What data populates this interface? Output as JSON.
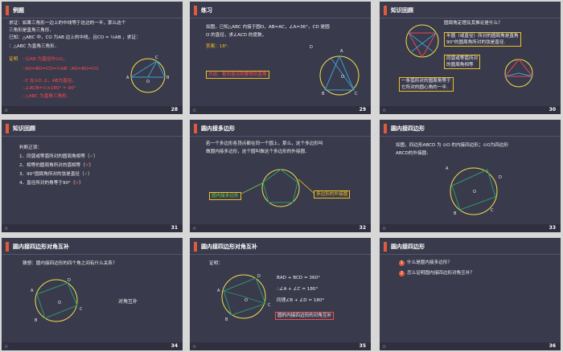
{
  "slides": [
    {
      "title": "例题",
      "num": "28",
      "lines": [
        "求证：如果三角形一边上的中线等于这边的一半，那么这个",
        "三角形是直角三角形．",
        "已知：△ABC 中，CO 为AB 边上的中线，且CO = ½AB ，求证：",
        "：△ABC 为直角三角形．"
      ],
      "proof_label": "证明",
      "proof": [
        "∵以AB 为直径作⊙O，",
        "∵AO=BO=CO=½AB  ∴AO=BO=CO",
        "∴C 在⊙O 上，AB为直径，",
        "∴∠ACB=½×180° = 90°",
        "∴△ABC 为直角三角形．"
      ],
      "fig": {
        "A": "A",
        "B": "B",
        "C": "C",
        "O": "O"
      }
    },
    {
      "title": "练习",
      "num": "29",
      "lines": [
        "如图，已知△ABC 内接于圆O，AB=AC，∠A=36°，CD 是圆",
        "O 的直径，求∠ACD 的度数，"
      ],
      "answer": "答案：18°.",
      "note": "总结：看到直径就要想到直角",
      "fig": {
        "A": "A",
        "B": "B",
        "C": "C",
        "D": "D",
        "O": "O"
      }
    },
    {
      "title": "知识回顾",
      "num": "30",
      "question": "圆周角定理及其推论是什么？",
      "box1": [
        "半圆（或直径）所对的圆周角是直角",
        "90°的圆周角所对的弦是直径."
      ],
      "box2": [
        "同弧或等弧所对",
        "的圆周角相等"
      ],
      "box3": [
        "一条弧所对的圆周角等于",
        "它所对的圆心角的一半."
      ]
    },
    {
      "title": "知识回顾",
      "num": "31",
      "intro": "判断正误：",
      "items": [
        "1．同弧或等弧所对的圆周角相等（",
        "2．相等的圆周角所对的弧相等（",
        "3．90°圆周角所对的弦是直径（",
        "4．直径所对的角等于90°（"
      ],
      "marks": [
        "✓",
        "✕",
        "✓",
        "✕"
      ],
      "close": "）"
    },
    {
      "title": "圆内接多边形",
      "num": "32",
      "lines": [
        "若一个多边形各顶点都在同一个圆上，那么，这个多边形叫",
        "做圆内接多边形，这个圆叫做这个多边形的外接圆．"
      ],
      "label1": "圆内接多边形",
      "label2": "多边形的外接圆"
    },
    {
      "title": "圆内接四边形",
      "num": "33",
      "lines": [
        "如图，四边形ABCD 为 ⊙O 的内接四边形；⊙O为四边形",
        "ABCD的外接圆．"
      ],
      "fig": {
        "A": "A",
        "B": "B",
        "C": "C",
        "D": "D",
        "O": "O"
      }
    },
    {
      "title": "圆内接四边形对角互补",
      "num": "34",
      "line": "猜想：圆内接四边形的四个角之间有什么关系？",
      "answer": "对角互补",
      "fig": {
        "A": "A",
        "B": "B",
        "C": "C",
        "D": "D",
        "O": "O"
      }
    },
    {
      "title": "圆内接四边形对角互补",
      "num": "35",
      "label": "证明：",
      "proof": [
        "BAD + BCD = 360°",
        "∴∠A + ∠C = 180°",
        "同理∠B + ∠D = 180°"
      ],
      "conclusion": "圆的内接四边形的对角互补",
      "fig": {
        "A": "A",
        "B": "B",
        "C": "C",
        "D": "D",
        "O": "O"
      }
    },
    {
      "title": "圆内接四边形",
      "num": "36",
      "items": [
        "什么是圆内接多边形？",
        "怎么证明圆内接四边形对角互补？"
      ]
    }
  ]
}
